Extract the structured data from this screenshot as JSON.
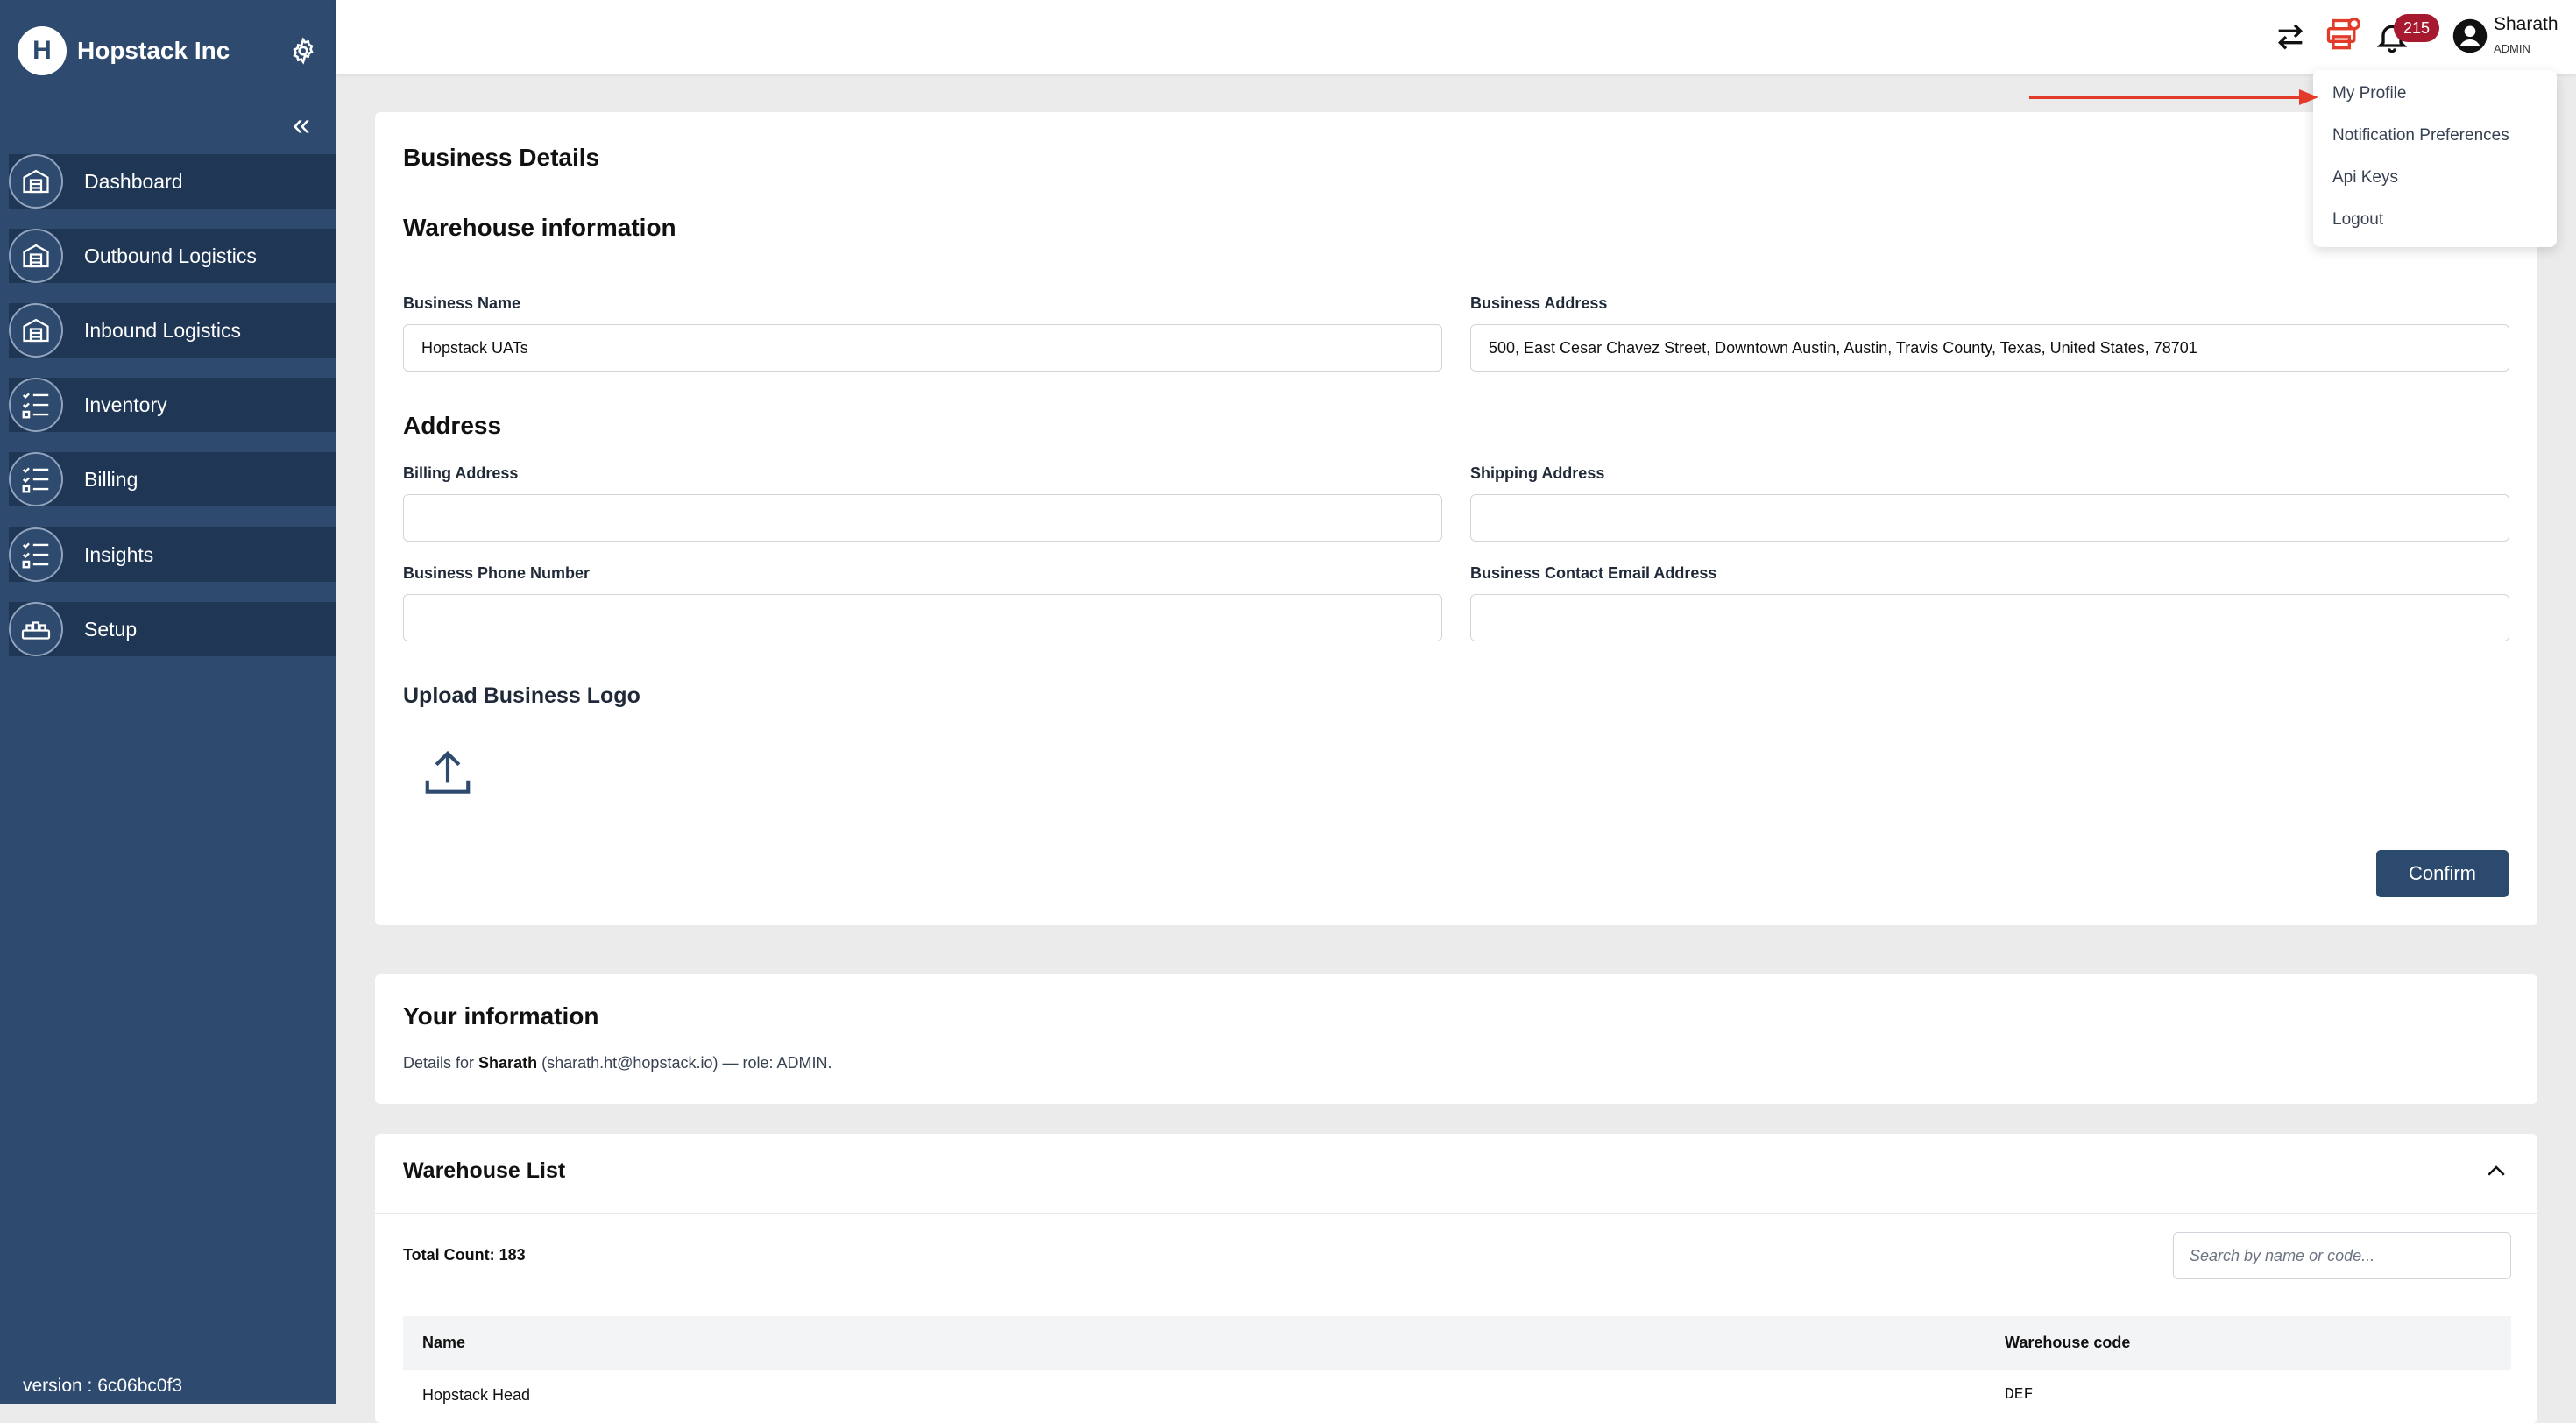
{
  "sidebar": {
    "brand": "Hopstack Inc",
    "logo_letter": "H",
    "items": [
      {
        "label": "Dashboard"
      },
      {
        "label": "Outbound Logistics"
      },
      {
        "label": "Inbound Logistics"
      },
      {
        "label": "Inventory"
      },
      {
        "label": "Billing"
      },
      {
        "label": "Insights"
      },
      {
        "label": "Setup"
      }
    ],
    "version": "version : 6c06bc0f3"
  },
  "topbar": {
    "notification_count": "215",
    "user_name": "Sharath",
    "user_role": "ADMIN"
  },
  "user_menu": {
    "items": [
      {
        "label": "My Profile"
      },
      {
        "label": "Notification Preferences"
      },
      {
        "label": "Api Keys"
      },
      {
        "label": "Logout"
      }
    ]
  },
  "business": {
    "title": "Business Details",
    "warehouse_heading": "Warehouse information",
    "business_name_label": "Business Name",
    "business_name_value": "Hopstack UATs",
    "business_address_label": "Business Address",
    "business_address_value": "500, East Cesar Chavez Street, Downtown Austin, Austin, Travis County, Texas, United States, 78701",
    "address_heading": "Address",
    "billing_address_label": "Billing Address",
    "shipping_address_label": "Shipping Address",
    "phone_label": "Business Phone Number",
    "email_label": "Business Contact Email Address",
    "upload_heading": "Upload Business Logo",
    "confirm_label": "Confirm"
  },
  "your_info": {
    "title": "Your information",
    "prefix": "Details for",
    "name": "Sharath",
    "suffix": "(sharath.ht@hopstack.io) — role: ADMIN."
  },
  "warehouse_list": {
    "title": "Warehouse List",
    "total_label": "Total Count: ",
    "total_value": "183",
    "search_placeholder": "Search by name or code...",
    "columns": [
      "Name",
      "Warehouse code"
    ],
    "rows": [
      {
        "name": "Hopstack Head",
        "code": "DEF"
      }
    ]
  },
  "colors": {
    "sidebar": "#2e4a6e",
    "nav_item": "#1f3655",
    "accent_red": "#e23b2a",
    "badge": "#a6192e"
  }
}
